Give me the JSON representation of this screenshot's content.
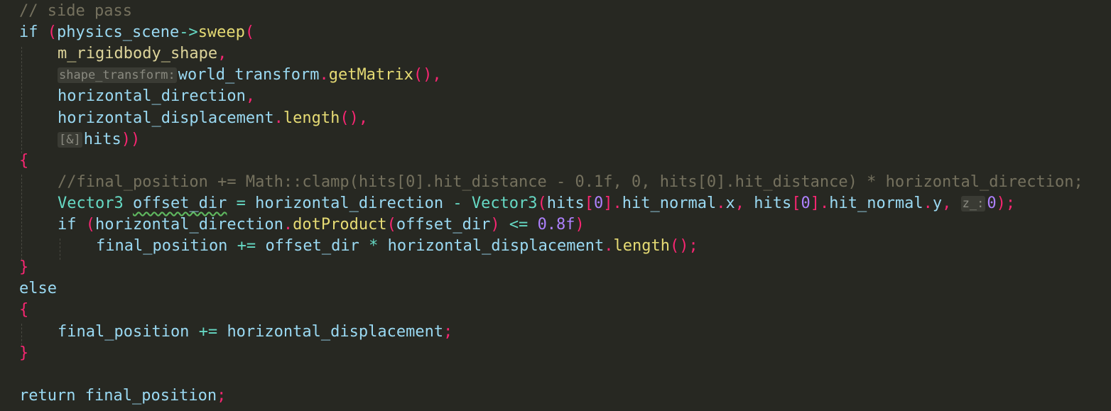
{
  "editor": {
    "lines": [
      {
        "indent": 1,
        "tokens": [
          {
            "t": "// side pass",
            "k": "comment"
          }
        ]
      },
      {
        "indent": 1,
        "tokens": [
          {
            "t": "if",
            "k": "kw"
          },
          {
            "t": " ",
            "k": "plain"
          },
          {
            "t": "(",
            "k": "punc"
          },
          {
            "t": "physics_scene",
            "k": "var"
          },
          {
            "t": "->",
            "k": "op"
          },
          {
            "t": "sweep",
            "k": "func"
          },
          {
            "t": "(",
            "k": "punc"
          }
        ]
      },
      {
        "indent": 3,
        "tokens": [
          {
            "t": "m_rigidbody_shape",
            "k": "param"
          },
          {
            "t": ",",
            "k": "punc"
          }
        ]
      },
      {
        "indent": 3,
        "tokens": [
          {
            "t": "shape_transform:",
            "k": "hint"
          },
          {
            "t": "world_transform",
            "k": "var"
          },
          {
            "t": ".",
            "k": "punc"
          },
          {
            "t": "getMatrix",
            "k": "func"
          },
          {
            "t": "()",
            "k": "punc"
          },
          {
            "t": ",",
            "k": "punc"
          }
        ]
      },
      {
        "indent": 3,
        "tokens": [
          {
            "t": "horizontal_direction",
            "k": "var"
          },
          {
            "t": ",",
            "k": "punc"
          }
        ]
      },
      {
        "indent": 3,
        "tokens": [
          {
            "t": "horizontal_displacement",
            "k": "var"
          },
          {
            "t": ".",
            "k": "punc"
          },
          {
            "t": "length",
            "k": "func"
          },
          {
            "t": "()",
            "k": "punc"
          },
          {
            "t": ",",
            "k": "punc"
          }
        ]
      },
      {
        "indent": 3,
        "tokens": [
          {
            "t": "[&]",
            "k": "hint"
          },
          {
            "t": "hits",
            "k": "var"
          },
          {
            "t": "))",
            "k": "punc"
          }
        ]
      },
      {
        "indent": 1,
        "tokens": [
          {
            "t": "{",
            "k": "punc"
          }
        ]
      },
      {
        "indent": 3,
        "tokens": [
          {
            "t": "//final_position += Math::clamp(hits[0].hit_distance - 0.1f, 0, hits[0].hit_distance) * horizontal_direction;",
            "k": "comment"
          }
        ]
      },
      {
        "indent": 3,
        "tokens": [
          {
            "t": "Vector3",
            "k": "type"
          },
          {
            "t": " ",
            "k": "plain"
          },
          {
            "t": "offset_dir",
            "k": "squig"
          },
          {
            "t": " ",
            "k": "plain"
          },
          {
            "t": "=",
            "k": "op"
          },
          {
            "t": " ",
            "k": "plain"
          },
          {
            "t": "horizontal_direction",
            "k": "var"
          },
          {
            "t": " ",
            "k": "plain"
          },
          {
            "t": "-",
            "k": "op"
          },
          {
            "t": " ",
            "k": "plain"
          },
          {
            "t": "Vector3",
            "k": "type"
          },
          {
            "t": "(",
            "k": "punc"
          },
          {
            "t": "hits",
            "k": "var"
          },
          {
            "t": "[",
            "k": "punc"
          },
          {
            "t": "0",
            "k": "num"
          },
          {
            "t": "]",
            "k": "punc"
          },
          {
            "t": ".",
            "k": "punc"
          },
          {
            "t": "hit_normal",
            "k": "member"
          },
          {
            "t": ".",
            "k": "punc"
          },
          {
            "t": "x",
            "k": "member"
          },
          {
            "t": ",",
            "k": "punc"
          },
          {
            "t": " ",
            "k": "plain"
          },
          {
            "t": "hits",
            "k": "var"
          },
          {
            "t": "[",
            "k": "punc"
          },
          {
            "t": "0",
            "k": "num"
          },
          {
            "t": "]",
            "k": "punc"
          },
          {
            "t": ".",
            "k": "punc"
          },
          {
            "t": "hit_normal",
            "k": "member"
          },
          {
            "t": ".",
            "k": "punc"
          },
          {
            "t": "y",
            "k": "member"
          },
          {
            "t": ",",
            "k": "punc"
          },
          {
            "t": " ",
            "k": "plain"
          },
          {
            "t": "z_:",
            "k": "hint"
          },
          {
            "t": "0",
            "k": "num"
          },
          {
            "t": ");",
            "k": "punc"
          }
        ]
      },
      {
        "indent": 3,
        "tokens": [
          {
            "t": "if",
            "k": "kw"
          },
          {
            "t": " ",
            "k": "plain"
          },
          {
            "t": "(",
            "k": "punc"
          },
          {
            "t": "horizontal_direction",
            "k": "var"
          },
          {
            "t": ".",
            "k": "punc"
          },
          {
            "t": "dotProduct",
            "k": "func"
          },
          {
            "t": "(",
            "k": "punc"
          },
          {
            "t": "offset_dir",
            "k": "var"
          },
          {
            "t": ")",
            "k": "punc"
          },
          {
            "t": " ",
            "k": "plain"
          },
          {
            "t": "<=",
            "k": "op"
          },
          {
            "t": " ",
            "k": "plain"
          },
          {
            "t": "0.8f",
            "k": "num"
          },
          {
            "t": ")",
            "k": "punc"
          }
        ]
      },
      {
        "indent": 5,
        "tokens": [
          {
            "t": "final_position",
            "k": "var"
          },
          {
            "t": " ",
            "k": "plain"
          },
          {
            "t": "+=",
            "k": "op"
          },
          {
            "t": " ",
            "k": "plain"
          },
          {
            "t": "offset_dir",
            "k": "var"
          },
          {
            "t": " ",
            "k": "plain"
          },
          {
            "t": "*",
            "k": "op"
          },
          {
            "t": " ",
            "k": "plain"
          },
          {
            "t": "horizontal_displacement",
            "k": "var"
          },
          {
            "t": ".",
            "k": "punc"
          },
          {
            "t": "length",
            "k": "func"
          },
          {
            "t": "();",
            "k": "punc"
          }
        ]
      },
      {
        "indent": 1,
        "tokens": [
          {
            "t": "}",
            "k": "punc"
          }
        ]
      },
      {
        "indent": 1,
        "tokens": [
          {
            "t": "else",
            "k": "kw"
          }
        ]
      },
      {
        "indent": 1,
        "tokens": [
          {
            "t": "{",
            "k": "punc"
          }
        ]
      },
      {
        "indent": 3,
        "tokens": [
          {
            "t": "final_position",
            "k": "var"
          },
          {
            "t": " ",
            "k": "plain"
          },
          {
            "t": "+=",
            "k": "op"
          },
          {
            "t": " ",
            "k": "plain"
          },
          {
            "t": "horizontal_displacement",
            "k": "var"
          },
          {
            "t": ";",
            "k": "punc"
          }
        ]
      },
      {
        "indent": 1,
        "tokens": [
          {
            "t": "}",
            "k": "punc"
          }
        ]
      },
      {
        "indent": 1,
        "tokens": []
      },
      {
        "indent": 1,
        "tokens": [
          {
            "t": "return",
            "k": "kw"
          },
          {
            "t": " ",
            "k": "plain"
          },
          {
            "t": "final_position",
            "k": "var"
          },
          {
            "t": ";",
            "k": "punc"
          }
        ]
      }
    ]
  }
}
